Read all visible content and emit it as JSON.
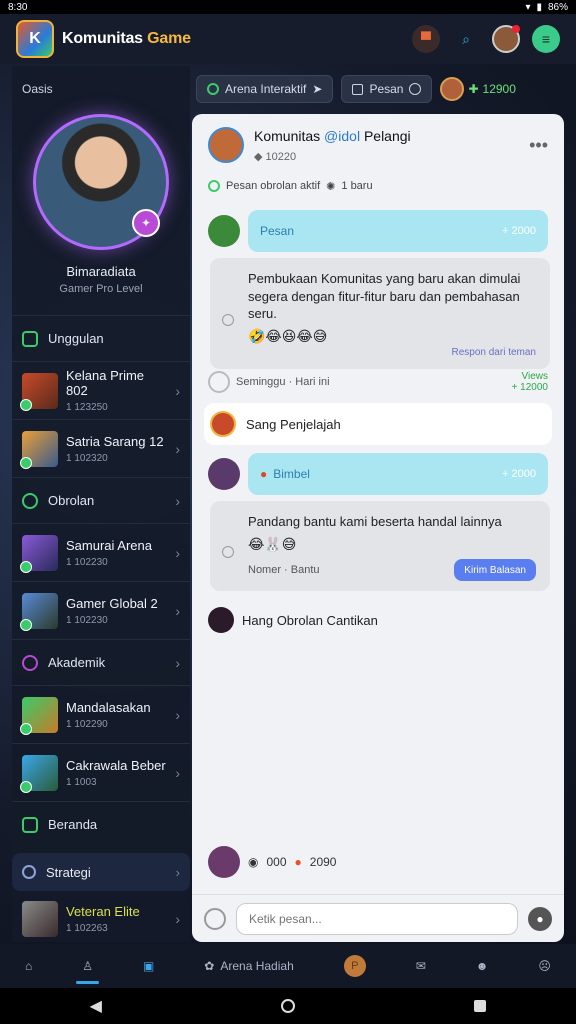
{
  "status_bar": {
    "time": "8:30",
    "battery": "86%"
  },
  "app": {
    "title_main": "Komunitas ",
    "title_accent": "Game"
  },
  "sidebar": {
    "heading": "Oasis",
    "profile": {
      "name": "Bimaradiata",
      "subtitle": "Gamer Pro Level"
    },
    "sections": [
      "Unggulan",
      "Obrolan",
      "Akademik",
      "Beranda"
    ],
    "items": [
      {
        "title": "Kelana Prime 802",
        "meta": "1 123250"
      },
      {
        "title": "Satria Sarang 12",
        "meta": "1 102320"
      },
      {
        "title": "Samurai Arena",
        "meta": "1 102230"
      },
      {
        "title": "Gamer Global 2",
        "meta": "1 102230"
      },
      {
        "title": "Mandalasakan",
        "meta": "1 102290"
      },
      {
        "title": "Cakrawala Beber",
        "meta": "1 1003"
      }
    ],
    "strategy": "Strategi",
    "bottom_item": {
      "title": "Veteran Elite",
      "meta": "1 102263"
    }
  },
  "filters": {
    "pill1": "Arena Interaktif",
    "pill2": "Pesan",
    "coins": "12900",
    "colors": {
      "coin": "#6ee07a"
    }
  },
  "chat": {
    "title": "Komunitas ",
    "title_tag": "@idol",
    "title_rest": " Pelangi",
    "subtitle": "10220",
    "status": "Pesan obrolan aktif",
    "status_extra": "1 baru",
    "msg1": {
      "label": "Pesan",
      "time": "+ 2000",
      "text": "Pembukaan Komunitas yang baru akan dimulai segera dengan fitur-fitur baru dan pembahasan seru.",
      "emojis": "🤣😂😆😂😅",
      "reaction": "Respon dari teman"
    },
    "meta1": {
      "label": "Seminggu · Hari ini",
      "views": "Views",
      "count": "+ 12000"
    },
    "card1": "Sang Penjelajah",
    "msg2": {
      "label": "Bimbel",
      "time": "+ 2000",
      "text": "Pandang bantu kami beserta handal lainnya",
      "emojis": "😂🐰😅"
    },
    "meta2": {
      "label": "Nomer · Bantu",
      "action": "Kirim Balasan"
    },
    "card2": "Hang Obrolan Cantikan",
    "footer": {
      "count1": "000",
      "count2": "2090"
    },
    "input_placeholder": "Ketik pesan..."
  },
  "nav": {
    "item_label": "Arena Hadiah",
    "coin": "P"
  }
}
